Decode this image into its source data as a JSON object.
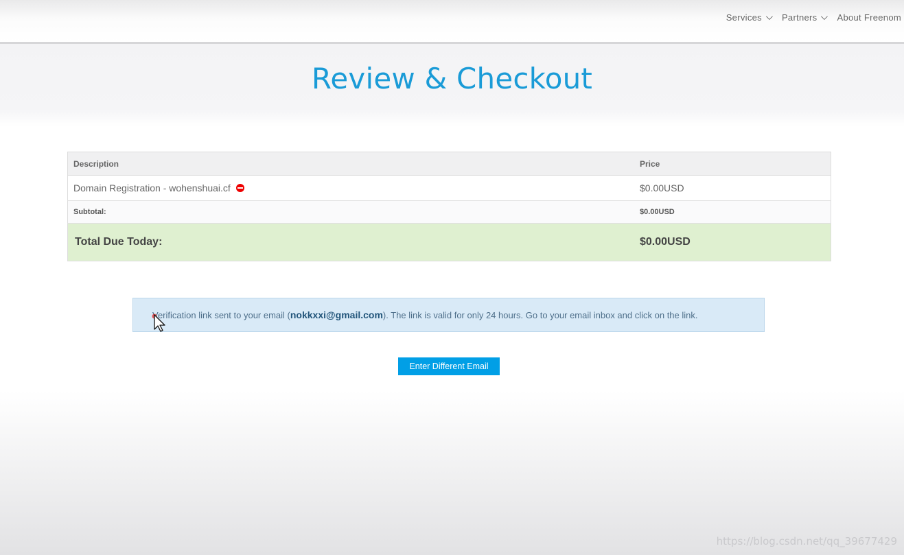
{
  "nav": {
    "items": [
      {
        "label": "Services"
      },
      {
        "label": "Partners"
      },
      {
        "label": "About Freenom"
      }
    ]
  },
  "page": {
    "title": "Review & Checkout"
  },
  "cart": {
    "headers": {
      "description": "Description",
      "price": "Price"
    },
    "item": {
      "description": "Domain Registration - wohenshuai.cf",
      "price": "$0.00USD"
    },
    "subtotal": {
      "label": "Subtotal:",
      "value": "$0.00USD"
    },
    "total": {
      "label": "Total Due Today:",
      "value": "$0.00USD"
    }
  },
  "alert": {
    "prefix": "Verification link sent to your email (",
    "email": "nokkxxi@gmail.com",
    "suffix": "). The link is valid for only 24 hours. Go to your email inbox and click on the link."
  },
  "button": {
    "label": "Enter Different Email"
  },
  "watermark": "https://blog.csdn.net/qq_39677429",
  "colors": {
    "accent": "#1a9bd7",
    "button": "#019fe6",
    "total_bg": "#dff0d0",
    "alert_bg": "#d9eaf7",
    "remove": "#ee0000"
  },
  "icons": {
    "remove": "remove-icon",
    "nav_chevron": "chevron-down-icon",
    "cursor": "mouse-cursor-icon"
  }
}
